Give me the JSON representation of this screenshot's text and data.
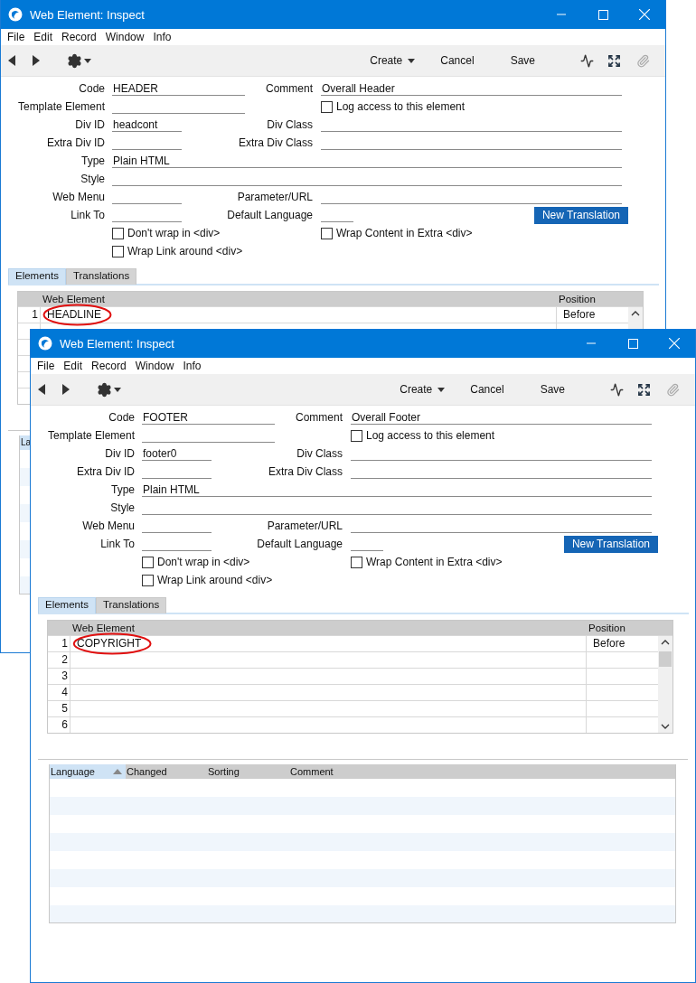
{
  "windows": [
    {
      "title": "Web Element: Inspect",
      "menu": [
        "File",
        "Edit",
        "Record",
        "Window",
        "Info"
      ],
      "toolbar": {
        "create": "Create",
        "cancel": "Cancel",
        "save": "Save"
      },
      "form": {
        "code": {
          "label": "Code",
          "value": "HEADER"
        },
        "comment": {
          "label": "Comment",
          "value": "Overall Header"
        },
        "template_element": {
          "label": "Template Element"
        },
        "log_access": {
          "label": "Log access to this element",
          "checked": false
        },
        "div_id": {
          "label": "Div ID",
          "value": "headcont"
        },
        "div_class": {
          "label": "Div Class"
        },
        "extra_div_id": {
          "label": "Extra Div ID"
        },
        "extra_div_class": {
          "label": "Extra Div Class"
        },
        "type": {
          "label": "Type",
          "value": "Plain HTML"
        },
        "style": {
          "label": "Style"
        },
        "web_menu": {
          "label": "Web Menu"
        },
        "parameter_url": {
          "label": "Parameter/URL"
        },
        "link_to": {
          "label": "Link To"
        },
        "default_language": {
          "label": "Default Language"
        },
        "new_translation": "New Translation",
        "dont_wrap": {
          "label": "Don't wrap in <div>",
          "checked": false
        },
        "wrap_content": {
          "label": "Wrap Content in Extra <div>",
          "checked": false
        },
        "wrap_link": {
          "label": "Wrap Link around <div>",
          "checked": false
        }
      },
      "tabs": [
        {
          "label": "Elements",
          "selected": true
        },
        {
          "label": "Translations",
          "selected": false
        }
      ],
      "elements_table": {
        "columns": [
          "Web Element",
          "Position"
        ],
        "rows": [
          {
            "number": "1",
            "web_element": "HEADLINE",
            "position": "Before",
            "circled": true
          },
          {},
          {},
          {},
          {},
          {}
        ]
      },
      "translations_table": {
        "columns": [
          {
            "label": "La",
            "sorted": true
          }
        ]
      }
    },
    {
      "title": "Web Element: Inspect",
      "menu": [
        "File",
        "Edit",
        "Record",
        "Window",
        "Info"
      ],
      "toolbar": {
        "create": "Create",
        "cancel": "Cancel",
        "save": "Save"
      },
      "form": {
        "code": {
          "label": "Code",
          "value": "FOOTER"
        },
        "comment": {
          "label": "Comment",
          "value": "Overall Footer"
        },
        "template_element": {
          "label": "Template Element"
        },
        "log_access": {
          "label": "Log access to this element",
          "checked": false
        },
        "div_id": {
          "label": "Div ID",
          "value": "footer0"
        },
        "div_class": {
          "label": "Div Class"
        },
        "extra_div_id": {
          "label": "Extra Div ID"
        },
        "extra_div_class": {
          "label": "Extra Div Class"
        },
        "type": {
          "label": "Type",
          "value": "Plain HTML"
        },
        "style": {
          "label": "Style"
        },
        "web_menu": {
          "label": "Web Menu"
        },
        "parameter_url": {
          "label": "Parameter/URL"
        },
        "link_to": {
          "label": "Link To"
        },
        "default_language": {
          "label": "Default Language"
        },
        "new_translation": "New Translation",
        "dont_wrap": {
          "label": "Don't wrap in <div>",
          "checked": false
        },
        "wrap_content": {
          "label": "Wrap Content in Extra <div>",
          "checked": false
        },
        "wrap_link": {
          "label": "Wrap Link around <div>",
          "checked": false
        }
      },
      "tabs": [
        {
          "label": "Elements",
          "selected": true
        },
        {
          "label": "Translations",
          "selected": false
        }
      ],
      "elements_table": {
        "columns": [
          "Web Element",
          "Position"
        ],
        "rows": [
          {
            "number": "1",
            "web_element": "COPYRIGHT",
            "position": "Before",
            "circled": true
          },
          {
            "number": "2"
          },
          {
            "number": "3"
          },
          {
            "number": "4"
          },
          {
            "number": "5"
          },
          {
            "number": "6"
          }
        ]
      },
      "translations_table": {
        "columns": [
          {
            "label": "Language",
            "sorted": true
          },
          {
            "label": "Changed",
            "sorted": false
          },
          {
            "label": "Sorting",
            "sorted": false
          },
          {
            "label": "Comment",
            "sorted": false
          }
        ]
      }
    }
  ]
}
